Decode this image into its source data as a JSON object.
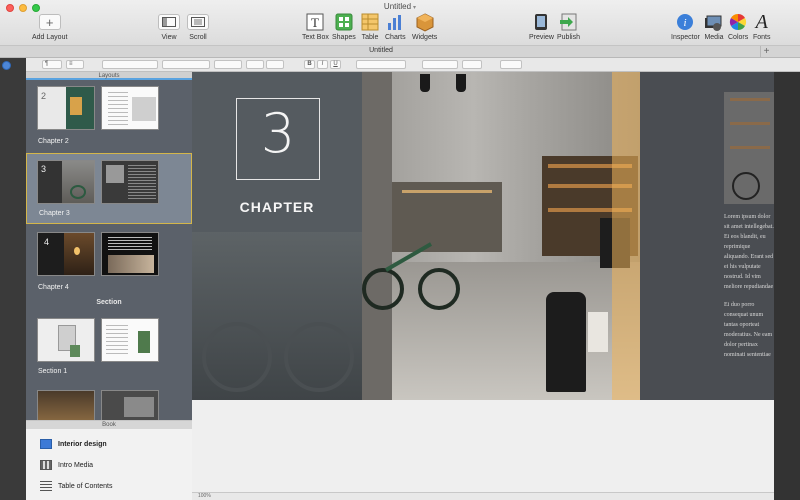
{
  "window": {
    "title": "Untitled"
  },
  "toolbar": {
    "add_layout": "Add Layout",
    "view": "View",
    "scroll": "Scroll",
    "textbox": "Text Box",
    "shapes": "Shapes",
    "table": "Table",
    "charts": "Charts",
    "widgets": "Widgets",
    "preview": "Preview",
    "publish": "Publish",
    "inspector": "Inspector",
    "media": "Media",
    "colors": "Colors",
    "fonts": "Fonts"
  },
  "tab": {
    "title": "Untitled",
    "add": "+"
  },
  "formatbar": {
    "paragraph": "¶",
    "list": "≡",
    "bold": "B",
    "italic": "I",
    "underline": "U"
  },
  "sidebar": {
    "header": "Layouts",
    "chapters": [
      {
        "label": "Chapter 2",
        "num": "2"
      },
      {
        "label": "Chapter 3",
        "num": "3"
      },
      {
        "label": "Chapter 4",
        "num": "4"
      }
    ],
    "section_label": "Section",
    "section1": "Section 1"
  },
  "book": {
    "header": "Book",
    "items": [
      {
        "label": "Interior design"
      },
      {
        "label": "Intro Media"
      },
      {
        "label": "Table of Contents"
      }
    ]
  },
  "page": {
    "chapter_number": "3",
    "chapter_word": "CHAPTER",
    "lorem_1": "Lorem ipsum dolor sit amet intellegebat. Ei eos blandit, eu reprimique aliquando. Erant sed ei his vulputate nostrud. Id vim meliore repudiandae te est. Via ea consul",
    "lorem_2": "Ei duo porro consequat unum tantas oporteat moderatius. Ne eam dolor pertinax nominati sententiae maxim atomorum"
  },
  "bottom": {
    "zoom": "100%"
  },
  "colors": {
    "accent": "#4d86d6",
    "selection_border": "#d4b64a",
    "sidebar_bg": "#5b616a"
  }
}
